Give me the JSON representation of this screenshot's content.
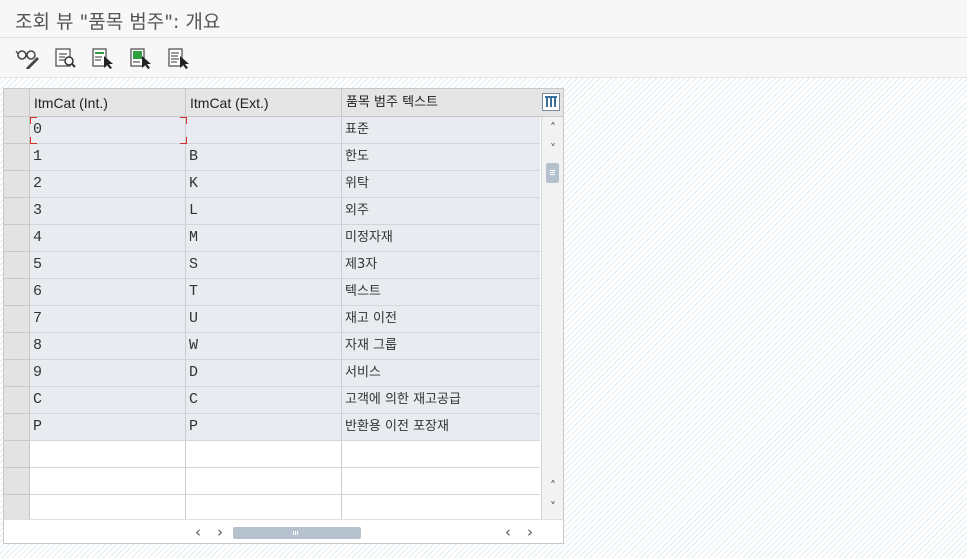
{
  "window": {
    "title": "조회 뷰 \"품목 범주\": 개요"
  },
  "toolbar": {
    "buttons": [
      {
        "icon": "glasses-pencil-icon"
      },
      {
        "icon": "display-details-icon"
      },
      {
        "icon": "select-all-icon"
      },
      {
        "icon": "select-block-icon"
      },
      {
        "icon": "deselect-all-icon"
      }
    ]
  },
  "table": {
    "columns": [
      {
        "label": "ItmCat (Int.)"
      },
      {
        "label": "ItmCat (Ext.)"
      },
      {
        "label": "품목 범주 텍스트"
      }
    ],
    "settings_icon": "column-settings-icon",
    "rows": [
      {
        "int": "0",
        "ext": "",
        "text": "표준"
      },
      {
        "int": "1",
        "ext": "B",
        "text": "한도"
      },
      {
        "int": "2",
        "ext": "K",
        "text": "위탁"
      },
      {
        "int": "3",
        "ext": "L",
        "text": "외주"
      },
      {
        "int": "4",
        "ext": "M",
        "text": "미정자재"
      },
      {
        "int": "5",
        "ext": "S",
        "text": "제3자"
      },
      {
        "int": "6",
        "ext": "T",
        "text": "텍스트"
      },
      {
        "int": "7",
        "ext": "U",
        "text": "재고 이전"
      },
      {
        "int": "8",
        "ext": "W",
        "text": "자재 그룹"
      },
      {
        "int": "9",
        "ext": "D",
        "text": "서비스"
      },
      {
        "int": "C",
        "ext": "C",
        "text": "고객에 의한 재고공급"
      },
      {
        "int": "P",
        "ext": "P",
        "text": "반환용 이전 포장재"
      }
    ],
    "empty_rows": 3
  },
  "scrollbars": {
    "up_glyph": "˄",
    "down_glyph": "˅",
    "left_glyph": "‹",
    "right_glyph": "›"
  }
}
